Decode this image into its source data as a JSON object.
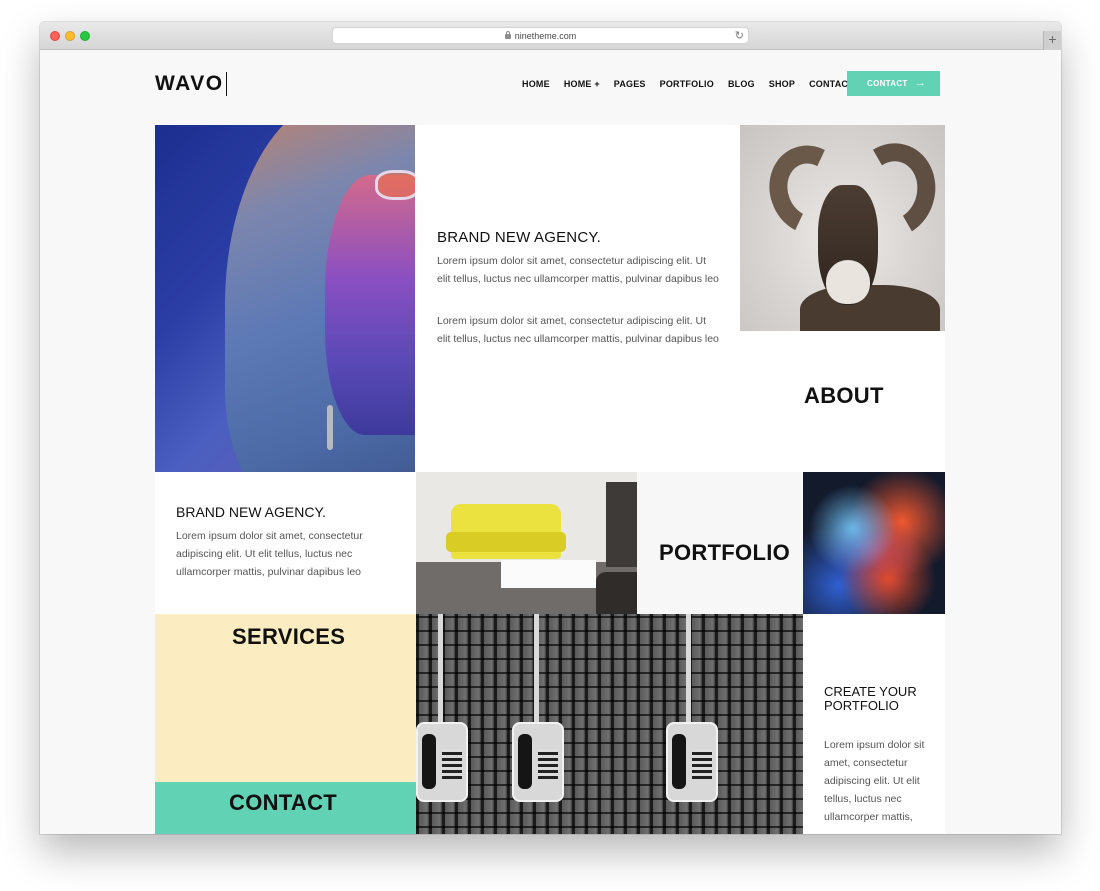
{
  "browser": {
    "url": "ninetheme.com",
    "new_tab_symbol": "+",
    "reload_symbol": "↻"
  },
  "header": {
    "logo": "WAVO",
    "nav": [
      "HOME",
      "HOME +",
      "PAGES",
      "PORTFOLIO",
      "BLOG",
      "SHOP",
      "CONTACT"
    ],
    "cta_label": "CONTACT",
    "cta_arrow": "→"
  },
  "tiles": {
    "agency_top": {
      "heading": "BRAND NEW AGENCY.",
      "paragraph_1": "Lorem ipsum dolor sit amet, consectetur adipiscing elit. Ut elit tellus, luctus nec ullamcorper mattis, pulvinar dapibus leo",
      "paragraph_2": "Lorem ipsum dolor sit amet, consectetur adipiscing elit. Ut elit tellus, luctus nec ullamcorper mattis, pulvinar dapibus leo"
    },
    "about": "ABOUT",
    "agency_mid": {
      "heading": "BRAND NEW AGENCY.",
      "paragraph": "Lorem ipsum dolor sit amet, consectetur adipiscing elit. Ut elit tellus, luctus nec ullamcorper mattis, pulvinar dapibus leo"
    },
    "portfolio": "PORTFOLIO",
    "services": "SERVICES",
    "contact": "CONTACT",
    "create": {
      "heading": "CREATE YOUR PORTFOLIO",
      "paragraph": "Lorem ipsum dolor sit amet, consectetur adipiscing elit. Ut elit tellus, luctus nec ullamcorper mattis,"
    }
  },
  "colors": {
    "accent": "#62d2b4",
    "services_bg": "#fbedc1",
    "page_bg": "#f8f8f8"
  },
  "icons": [
    "lock-icon",
    "reload-icon",
    "new-tab-icon",
    "arrow-right-icon"
  ]
}
